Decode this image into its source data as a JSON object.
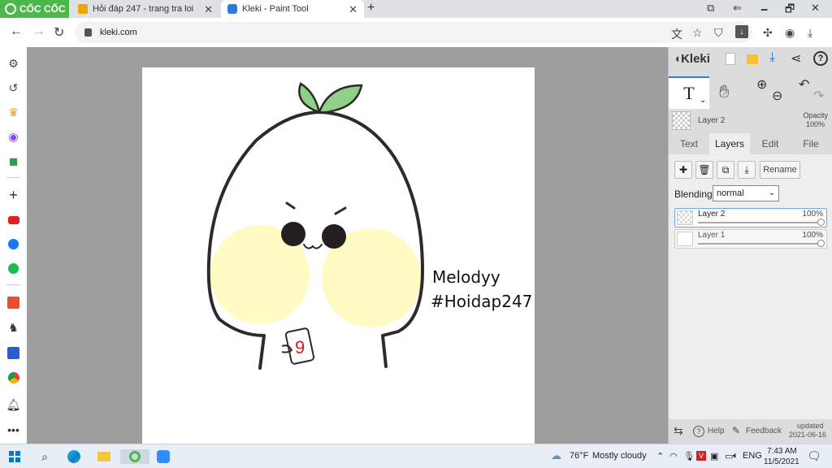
{
  "browser": {
    "brand": "CỐC CỐC",
    "tabs": [
      {
        "title": "Hỏi đáp 247 - trang tra loi",
        "close": "✕"
      },
      {
        "title": "Kleki - Paint Tool",
        "close": "✕"
      }
    ],
    "new_tab": "+",
    "url": "kleki.com",
    "window_controls": [
      "🗕",
      "🗗",
      "✕"
    ]
  },
  "sidebar": {
    "icons": [
      "gear-icon",
      "history-icon",
      "crown-icon",
      "messenger-icon",
      "game-icon",
      "plus-icon",
      "youtube-icon",
      "facebook-icon",
      "spotify-icon",
      "shopee-icon",
      "hero-icon",
      "sale-icon",
      "chrome-icon",
      "bell-icon",
      "more-icon"
    ]
  },
  "canvas": {
    "text_line1": "Melodyy",
    "text_line2": "#Hoidap247",
    "sticker_text": "9"
  },
  "panel": {
    "app_name": "Kleki",
    "tool_letter": "T",
    "current_layer_label": "Layer 2",
    "opacity_label": "Opacity",
    "opacity_value": "100%",
    "tabs": [
      "Text",
      "Layers",
      "Edit",
      "File"
    ],
    "active_tab": "Layers",
    "rename_label": "Rename",
    "blending_label": "Blending",
    "blending_value": "normal",
    "layers": [
      {
        "name": "Layer 2",
        "opacity": "100%",
        "selected": true
      },
      {
        "name": "Layer 1",
        "opacity": "100%",
        "selected": false
      }
    ],
    "footer": {
      "help": "Help",
      "feedback": "Feedback",
      "updated_label": "updated",
      "updated_date": "2021-06-16"
    }
  },
  "taskbar": {
    "weather_temp": "76°F",
    "weather_text": "Mostly cloudy",
    "lang": "ENG",
    "time": "7:43 AM",
    "date": "11/5/2021"
  },
  "colors": {
    "brand_green": "#4db84a",
    "accent_blue": "#2a7ae2",
    "canvas_grey": "#9e9e9e",
    "cheek_yellow": "#fffbc2",
    "leaf_green": "#8fd18a"
  }
}
